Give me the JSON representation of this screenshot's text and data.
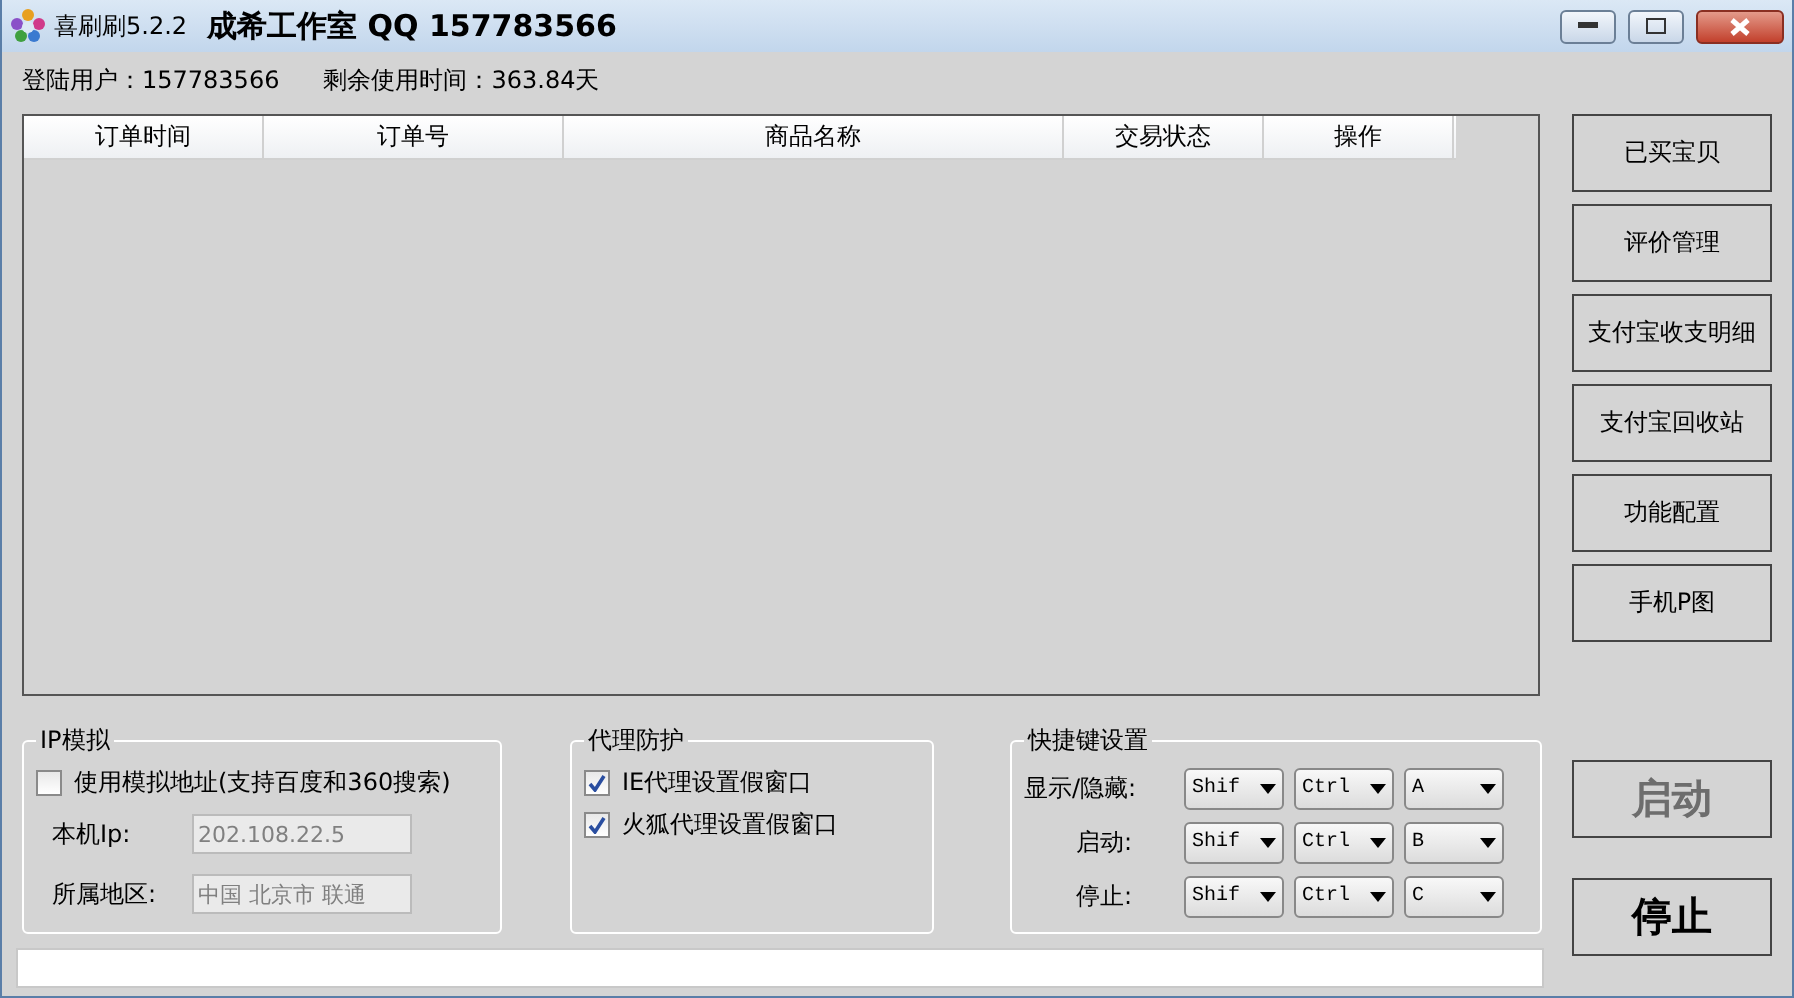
{
  "window": {
    "app_name": "喜刷刷5.2.2",
    "caption": "成希工作室 QQ 157783566"
  },
  "info": [
    "登陆用户：157783566",
    "剩余使用时间：363.84天"
  ],
  "table": {
    "columns": [
      "订单时间",
      "订单号",
      "商品名称",
      "交易状态",
      "操作"
    ]
  },
  "side_buttons": [
    "已买宝贝",
    "评价管理",
    "支付宝收支明细",
    "支付宝回收站",
    "功能配置",
    "手机P图"
  ],
  "ip_group": {
    "title": "IP模拟",
    "use_fake": {
      "label": "使用模拟地址(支持百度和360搜索)",
      "checked": false
    },
    "fields": [
      {
        "label": "本机Ip:",
        "value": "202.108.22.5",
        "disabled": true
      },
      {
        "label": "所属地区:",
        "value": "中国 北京市 联通",
        "disabled": true
      }
    ]
  },
  "proxy_group": {
    "title": "代理防护",
    "options": [
      {
        "label": "IE代理设置假窗口",
        "checked": true
      },
      {
        "label": "火狐代理设置假窗口",
        "checked": true
      }
    ]
  },
  "hotkeys": {
    "title": "快捷键设置",
    "rows": [
      {
        "label": "显示/隐藏:",
        "keys": [
          "Shif",
          "Ctrl",
          "A"
        ]
      },
      {
        "label": "启动:",
        "keys": [
          "Shif",
          "Ctrl",
          "B"
        ]
      },
      {
        "label": "停止:",
        "keys": [
          "Shif",
          "Ctrl",
          "C"
        ]
      }
    ]
  },
  "actions": [
    {
      "label": "启动",
      "disabled": true
    },
    {
      "label": "停止",
      "disabled": false
    }
  ]
}
